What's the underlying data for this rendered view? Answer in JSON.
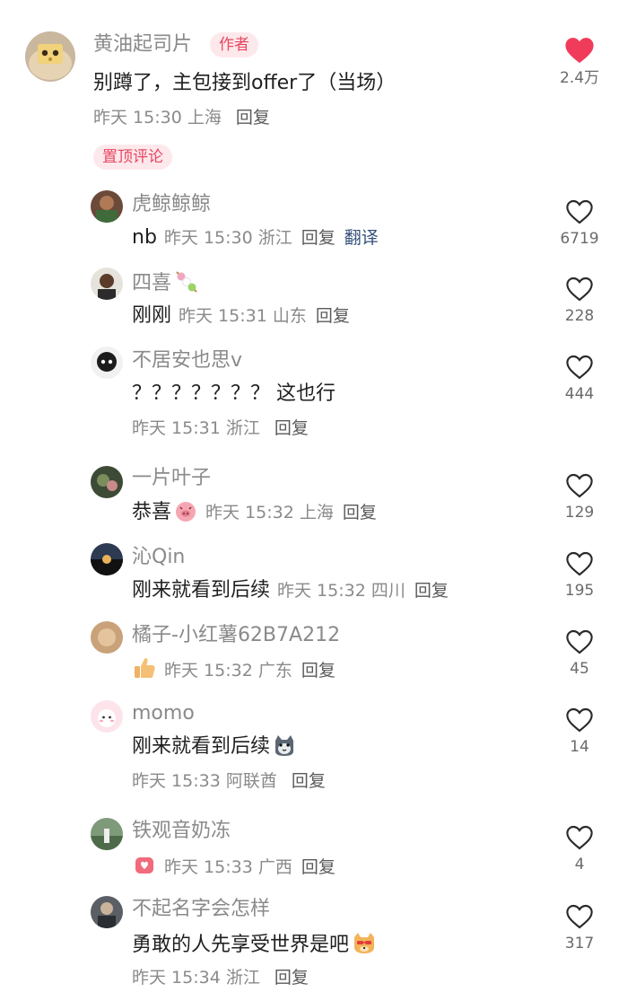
{
  "author_comment": {
    "username": "黄油起司片",
    "badge": "作者",
    "text": "别蹲了，主包接到offer了（当场）",
    "time": "昨天 15:30",
    "location": "上海",
    "reply_label": "回复",
    "pinned_label": "置顶评论",
    "likes": "2.4万",
    "liked": true
  },
  "comments": [
    {
      "username": "虎鲸鲸鲸",
      "text": "nb",
      "time": "昨天 15:30",
      "location": "浙江",
      "reply_label": "回复",
      "translate_label": "翻译",
      "likes": "6719"
    },
    {
      "username": "四喜",
      "text": "刚刚",
      "time": "昨天 15:31",
      "location": "山东",
      "reply_label": "回复",
      "likes": "228"
    },
    {
      "username": "不居安也思v",
      "text": "？？？？？？？ 这也行",
      "time": "昨天 15:31",
      "location": "浙江",
      "reply_label": "回复",
      "likes": "444"
    },
    {
      "username": "一片叶子",
      "text": "恭喜",
      "time": "昨天 15:32",
      "location": "上海",
      "reply_label": "回复",
      "likes": "129"
    },
    {
      "username": "沁Qin",
      "text": "刚来就看到后续",
      "time": "昨天 15:32",
      "location": "四川",
      "reply_label": "回复",
      "likes": "195"
    },
    {
      "username": "橘子-小红薯62B7A212",
      "text": "",
      "time": "昨天 15:32",
      "location": "广东",
      "reply_label": "回复",
      "likes": "45"
    },
    {
      "username": "momo",
      "text": "刚来就看到后续",
      "time": "昨天 15:33",
      "location": "阿联酋",
      "reply_label": "回复",
      "likes": "14"
    },
    {
      "username": "铁观音奶冻",
      "text": "",
      "time": "昨天 15:33",
      "location": "广西",
      "reply_label": "回复",
      "likes": "4"
    },
    {
      "username": "不起名字会怎样",
      "text": "勇敢的人先享受世界是吧",
      "time": "昨天 15:34",
      "location": "浙江",
      "reply_label": "回复",
      "likes": "317"
    }
  ],
  "icons": {
    "like_filled": "heart-filled-icon",
    "like_outline": "heart-outline-icon"
  },
  "colors": {
    "like_active": "#f13b5a",
    "badge_bg": "#fde8ec",
    "badge_text": "#e8465f",
    "username": "#8a8a8a",
    "translate_link": "#34507a"
  }
}
